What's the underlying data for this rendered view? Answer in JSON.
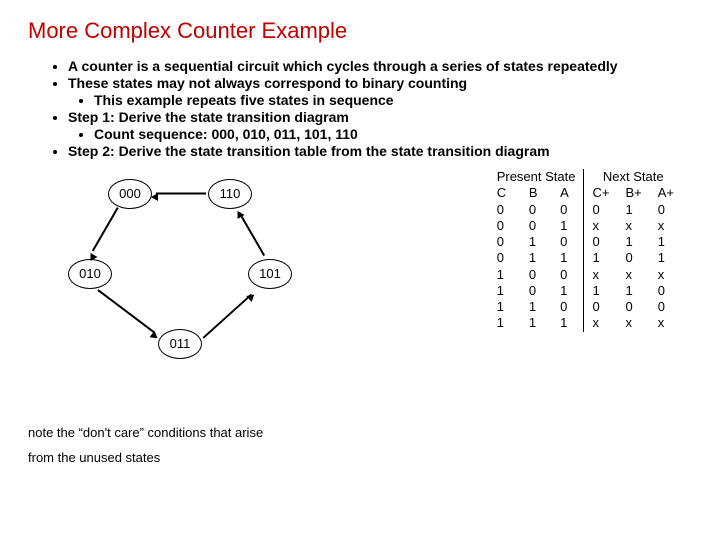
{
  "title": "More Complex Counter Example",
  "bullets": {
    "b1": "A counter is a sequential circuit which cycles through a series of states repeatedly",
    "b2": "These states may not always correspond to binary counting",
    "b2_1": "This example repeats five states in sequence",
    "b3": "Step 1: Derive the state transition diagram",
    "b3_1": "Count sequence: 000, 010, 011, 101, 110",
    "b4": "Step 2: Derive the state transition table from the state transition diagram"
  },
  "diagram": {
    "n0": "000",
    "n1": "110",
    "n2": "010",
    "n3": "101",
    "n4": "011"
  },
  "table": {
    "group_present": "Present State",
    "group_next": "Next State",
    "h_C": "C",
    "h_B": "B",
    "h_A": "A",
    "h_Cp": "C+",
    "h_Bp": "B+",
    "h_Ap": "A+",
    "rows": [
      {
        "c": "0",
        "b": "0",
        "a": "0",
        "cp": "0",
        "bp": "1",
        "ap": "0"
      },
      {
        "c": "0",
        "b": "0",
        "a": "1",
        "cp": "x",
        "bp": "x",
        "ap": "x"
      },
      {
        "c": "0",
        "b": "1",
        "a": "0",
        "cp": "0",
        "bp": "1",
        "ap": "1"
      },
      {
        "c": "0",
        "b": "1",
        "a": "1",
        "cp": "1",
        "bp": "0",
        "ap": "1"
      },
      {
        "c": "1",
        "b": "0",
        "a": "0",
        "cp": "x",
        "bp": "x",
        "ap": "x"
      },
      {
        "c": "1",
        "b": "0",
        "a": "1",
        "cp": "1",
        "bp": "1",
        "ap": "0"
      },
      {
        "c": "1",
        "b": "1",
        "a": "0",
        "cp": "0",
        "bp": "0",
        "ap": "0"
      },
      {
        "c": "1",
        "b": "1",
        "a": "1",
        "cp": "x",
        "bp": "x",
        "ap": "x"
      }
    ]
  },
  "note1": "note the “don't care” conditions that arise",
  "note2": "from the unused states",
  "chart_data": {
    "type": "table",
    "title": "State transition table for 5-state counter",
    "columns": [
      "C",
      "B",
      "A",
      "C+",
      "B+",
      "A+"
    ],
    "rows": [
      [
        "0",
        "0",
        "0",
        "0",
        "1",
        "0"
      ],
      [
        "0",
        "0",
        "1",
        "x",
        "x",
        "x"
      ],
      [
        "0",
        "1",
        "0",
        "0",
        "1",
        "1"
      ],
      [
        "0",
        "1",
        "1",
        "1",
        "0",
        "1"
      ],
      [
        "1",
        "0",
        "0",
        "x",
        "x",
        "x"
      ],
      [
        "1",
        "0",
        "1",
        "1",
        "1",
        "0"
      ],
      [
        "1",
        "1",
        "0",
        "0",
        "0",
        "0"
      ],
      [
        "1",
        "1",
        "1",
        "x",
        "x",
        "x"
      ]
    ],
    "state_diagram_cycle": [
      "000",
      "010",
      "011",
      "101",
      "110"
    ]
  }
}
